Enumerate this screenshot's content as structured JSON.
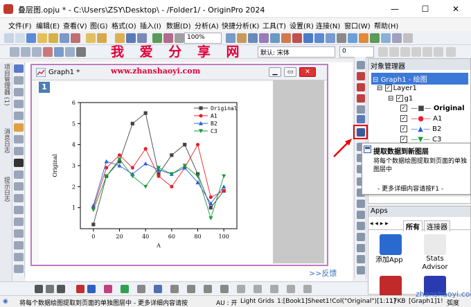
{
  "window": {
    "title": "叠层图.opju * - C:\\Users\\ZSY\\Desktop\\ - /Folder1/ - OriginPro 2024",
    "min": "—",
    "max": "☐",
    "close": "✕"
  },
  "menu": [
    "文件(F)",
    "编辑(E)",
    "查看(V)",
    "图(G)",
    "格式(O)",
    "插入(I)",
    "数据(D)",
    "分析(A)",
    "快捷分析(K)",
    "工具(T)",
    "设置(R)",
    "连接(N)",
    "窗口(W)",
    "帮助(H)"
  ],
  "toolbar": {
    "zoom": "100%",
    "font": "默认: 宋体",
    "font_size": "0"
  },
  "watermark": "我 爱 分 享 网",
  "url": "www.zhanshaoyi.com",
  "vtabs": [
    "项目管理器 (1)",
    "消息日志",
    "提示日志"
  ],
  "graph": {
    "title": "Graph1 *",
    "layer": "1",
    "feedback": ">>反馈"
  },
  "chart_data": {
    "type": "line",
    "x": [
      0,
      10,
      20,
      30,
      40,
      50,
      60,
      70,
      80,
      90,
      100
    ],
    "series": [
      {
        "name": "Original",
        "color": "#444444",
        "marker": "square",
        "values": [
          0.2,
          2.5,
          3.2,
          5.0,
          5.5,
          2.6,
          3.5,
          4.0,
          2.6,
          1.0,
          1.8
        ]
      },
      {
        "name": "A1",
        "color": "#e8202a",
        "marker": "circle",
        "values": [
          1.0,
          2.9,
          3.5,
          2.9,
          3.8,
          2.5,
          2.0,
          2.9,
          4.0,
          1.5,
          1.8
        ]
      },
      {
        "name": "B2",
        "color": "#2a5fd8",
        "marker": "triangle",
        "values": [
          1.1,
          3.2,
          3.0,
          2.6,
          3.1,
          2.8,
          2.6,
          2.9,
          2.2,
          1.2,
          2.0
        ]
      },
      {
        "name": "C3",
        "color": "#1a9a3a",
        "marker": "triangle-down",
        "values": [
          0.9,
          2.5,
          3.3,
          2.5,
          2.0,
          2.9,
          2.6,
          3.0,
          2.5,
          0.5,
          2.5
        ]
      }
    ],
    "xlabel": "A",
    "ylabel": "Original",
    "xlim": [
      -10,
      110
    ],
    "ylim": [
      0,
      6
    ],
    "xticks": [
      0,
      20,
      40,
      60,
      80,
      100
    ],
    "yticks": [
      1,
      2,
      3,
      4,
      5,
      6
    ],
    "legend": "top-right",
    "grid": false
  },
  "object_manager": {
    "title": "对象管理器",
    "items": [
      "Graph1 - 绘图",
      "Layer1",
      "g1",
      "Original",
      "A1",
      "B2",
      "C3"
    ]
  },
  "tooltip": {
    "title": "提取数据到新图层",
    "desc": "将每个数据绘图提取到页面的单独图层中",
    "more": "- 更多详细内容请按F1 -"
  },
  "apps": {
    "title": "Apps",
    "tab_all": "所有",
    "tab_conn": "连接器",
    "add_app": "添加App",
    "stats": "Stats Advisor"
  },
  "status": {
    "message": "将每个数据绘图提取到页面的单独图层中 - 更多详细内容请按",
    "au": "AU : 开",
    "theme": "Light Grids",
    "cell": "1:[Book1]Sheet1!Col(\"Original\")[1:11]",
    "size": "17KB",
    "graph": "[Graph1]1!",
    "angle": "弧度"
  },
  "logo_text": "zhanshaoyi.com"
}
